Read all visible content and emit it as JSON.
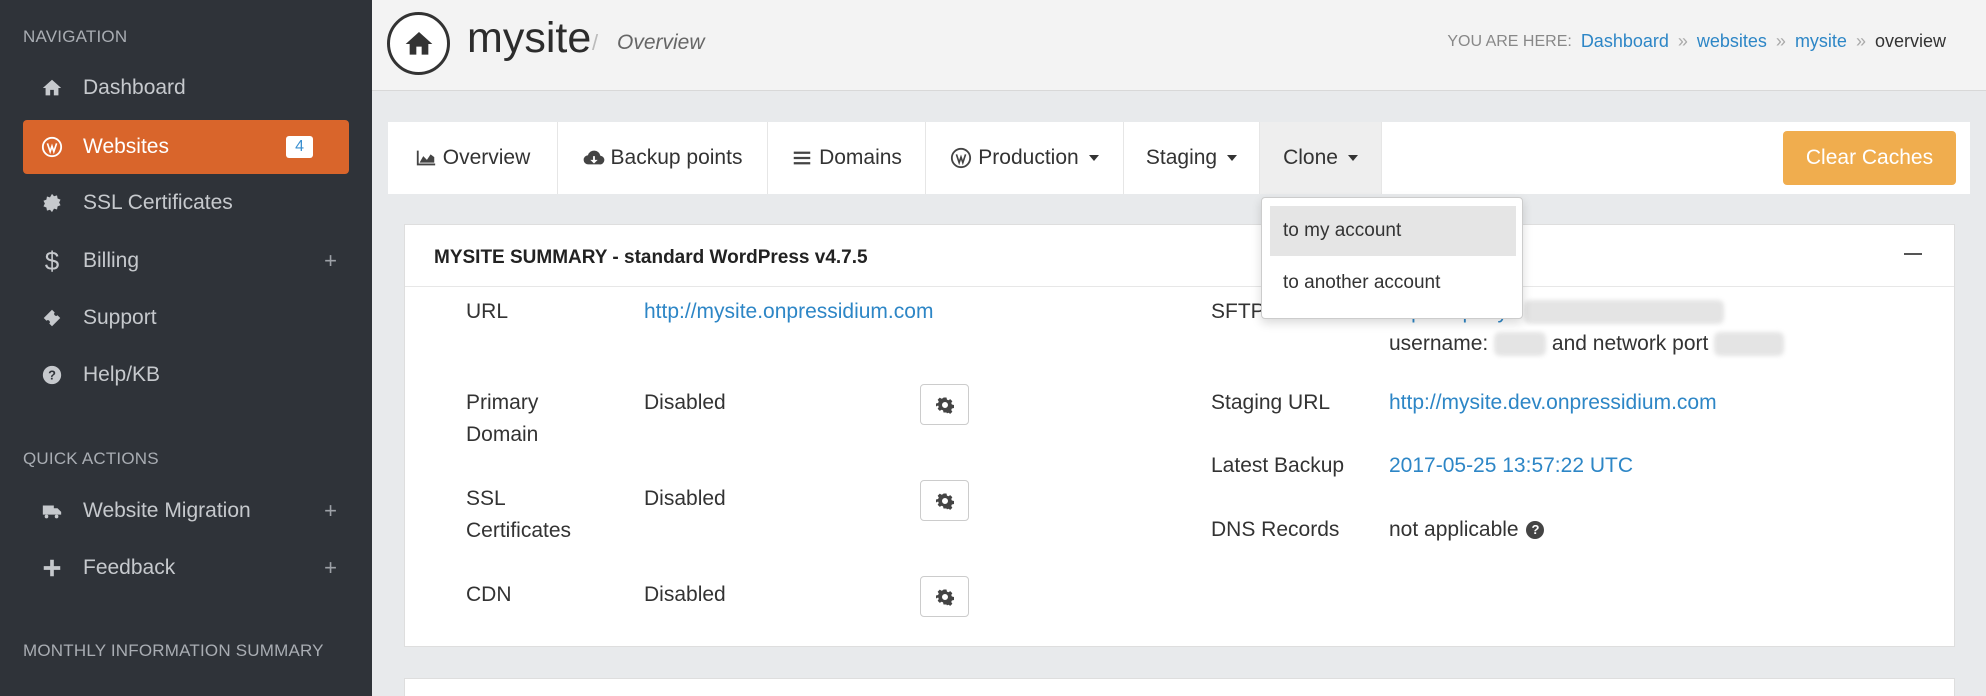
{
  "sidebar": {
    "nav_heading": "NAVIGATION",
    "items": [
      {
        "label": "Dashboard",
        "icon": "home-icon"
      },
      {
        "label": "Websites",
        "icon": "wordpress-icon",
        "badge": "4",
        "active": true
      },
      {
        "label": "SSL Certificates",
        "icon": "certificate-icon"
      },
      {
        "label": "Billing",
        "icon": "dollar-icon",
        "expand": "+"
      },
      {
        "label": "Support",
        "icon": "ticket-icon"
      },
      {
        "label": "Help/KB",
        "icon": "question-icon"
      }
    ],
    "quick_heading": "QUICK ACTIONS",
    "quick_items": [
      {
        "label": "Website Migration",
        "icon": "truck-icon",
        "expand": "+"
      },
      {
        "label": "Feedback",
        "icon": "plus-icon",
        "expand": "+"
      }
    ],
    "monthly_heading": "MONTHLY INFORMATION SUMMARY"
  },
  "header": {
    "title": "mysite",
    "separator": "/",
    "subtitle": "Overview",
    "breadcrumb": {
      "label": "YOU ARE HERE:",
      "links": [
        "Dashboard",
        "websites",
        "mysite"
      ],
      "separator": "»",
      "current": "overview"
    }
  },
  "tabs": [
    {
      "label": "Overview",
      "icon": "area-chart-icon"
    },
    {
      "label": "Backup points",
      "icon": "cloud-download-icon"
    },
    {
      "label": "Domains",
      "icon": "list-icon"
    },
    {
      "label": "Production",
      "icon": "wordpress-icon",
      "dropdown": true
    },
    {
      "label": "Staging",
      "dropdown": true
    },
    {
      "label": "Clone",
      "dropdown": true,
      "open": true
    }
  ],
  "clear_caches": "Clear Caches",
  "clone_menu": [
    "to my account",
    "to another account"
  ],
  "summary": {
    "title": "MYSITE SUMMARY - standard WordPress v4.7.5",
    "left": [
      {
        "label_lines": [
          "URL"
        ],
        "value": "http://mysite.onpressidium.com",
        "is_link": true
      },
      {
        "label_lines": [
          "Primary",
          "Domain"
        ],
        "value": "Disabled"
      },
      {
        "label_lines": [
          "SSL",
          "Certificates"
        ],
        "value": "Disabled"
      },
      {
        "label_lines": [
          "CDN"
        ],
        "value": "Disabled"
      }
    ],
    "right": {
      "sftp_label": "SFTP",
      "sftp_value": "sftp://sftp.mys",
      "username_label": "username:",
      "port_label": "and network port",
      "staging_label": "Staging URL",
      "staging_value": "http://mysite.dev.onpressidium.com",
      "backup_label": "Latest Backup",
      "backup_value": "2017-05-25 13:57:22 UTC",
      "dns_label": "DNS Records",
      "dns_value": "not applicable"
    }
  },
  "colors": {
    "sidebar_bg": "#2f3339",
    "active_item": "#d9652b",
    "link": "#2d86c6",
    "warning_button": "#f0ad4e"
  }
}
